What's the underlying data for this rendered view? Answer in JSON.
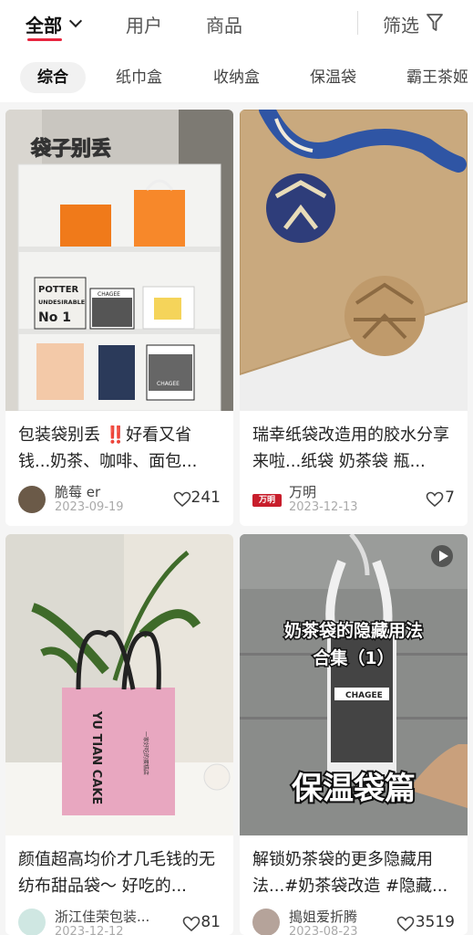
{
  "header": {
    "tabs": [
      {
        "label": "全部"
      },
      {
        "label": "用户"
      },
      {
        "label": "商品"
      }
    ],
    "filter_label": "筛选"
  },
  "chips": [
    "综合",
    "纸巾盒",
    "收纳盒",
    "保温袋",
    "霸王茶姬"
  ],
  "posts": [
    {
      "image_caption": "袋子别丢",
      "title": "包装袋别丢 ‼️好看又省钱...奶茶、咖啡、面包...",
      "author": "脆莓 er",
      "date": "2023-09-19",
      "likes": "241",
      "image_labels": [
        "POTTER",
        "UNDESIRABLE",
        "No 1",
        "CHAGEE",
        "CHAGEE"
      ]
    },
    {
      "title": "瑞幸纸袋改造用的胶水分享来啦...纸袋 奶茶袋 瓶...",
      "author": "万明",
      "author_badge": "万明",
      "date": "2023-12-13",
      "likes": "7"
    },
    {
      "title": "颜值超高均价才几毛钱的无纺布甜品袋～ 好吃的...",
      "author": "浙江佳荣包装...",
      "date": "2023-12-12",
      "likes": "81",
      "bag_text": "YU TIAN CAKE",
      "bag_subtext": "一家好吃的蛋糕店"
    },
    {
      "image_caption_1": "奶茶袋的隐藏用法",
      "image_caption_2": "合集（1）",
      "image_caption_3": "保温袋篇",
      "title": "解锁奶茶袋的更多隐藏用法...#奶茶袋改造 #隐藏...",
      "author": "搗姐爱折腾",
      "date": "2023-08-23",
      "likes": "3519",
      "bag_brand": "CHAGEE"
    }
  ],
  "colors": {
    "accent": "#e8263f"
  }
}
